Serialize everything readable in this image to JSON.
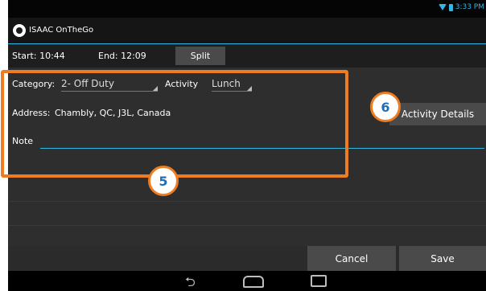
{
  "status_bar": {
    "time": "3:33 PM"
  },
  "app_bar": {
    "title": "ISAAC OnTheGo"
  },
  "time_row": {
    "start_label": "Start: 10:44",
    "end_label": "End: 12:09",
    "split_label": "Split"
  },
  "form": {
    "category_label": "Category:",
    "category_value": "2- Off Duty",
    "activity_label": "Activity",
    "activity_value": "Lunch",
    "address_label": "Address:",
    "address_value": "Chambly, QC, J3L, Canada",
    "note_label": "Note"
  },
  "actions": {
    "activity_details_label": "Activity Details",
    "cancel_label": "Cancel",
    "save_label": "Save"
  },
  "callouts": {
    "five": "5",
    "six": "6"
  },
  "colors": {
    "accent": "#31b6e7",
    "highlight": "#ee7d22",
    "callout_text": "#1e6fb8"
  },
  "icons": {
    "back": "back-icon",
    "home": "home-icon",
    "recent": "recent-apps-icon"
  }
}
